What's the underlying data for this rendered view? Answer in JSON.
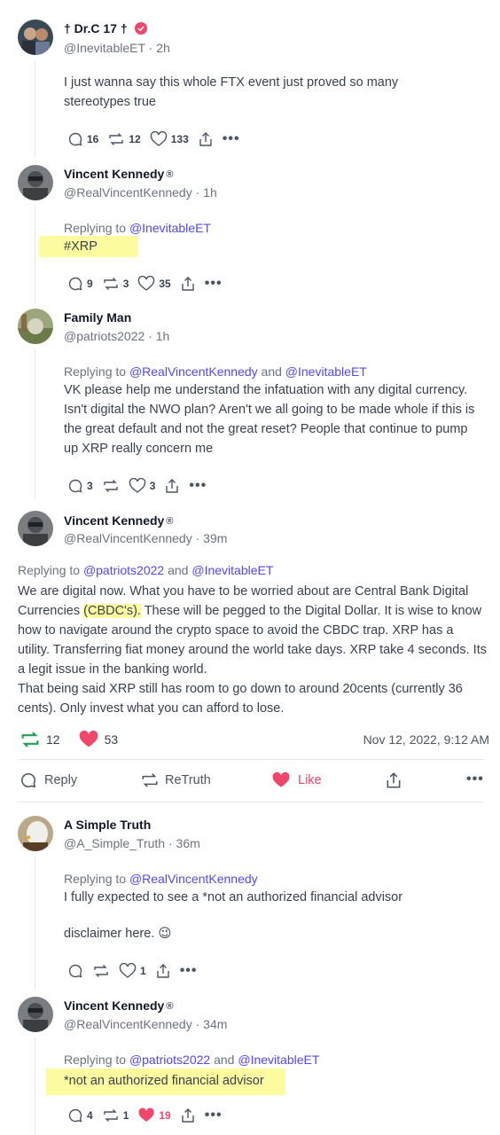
{
  "posts": [
    {
      "name": "† Dr.C 17 †",
      "handle": "@InevitableET",
      "time": "2h",
      "text": "I just wanna say this whole FTX event just proved so many stereotypes true",
      "replies": "16",
      "retruths": "12",
      "likes": "133"
    },
    {
      "name": "Vincent Kennedy",
      "handle": "@RealVincentKennedy",
      "time": "1h",
      "replying_label": "Replying to",
      "replying_to": "@InevitableET",
      "text": "#XRP",
      "replies": "9",
      "retruths": "3",
      "likes": "35"
    },
    {
      "name": "Family Man",
      "handle": "@patriots2022",
      "time": "1h",
      "replying_label": "Replying to",
      "replying_to": "@RealVincentKennedy",
      "and": "and",
      "replying_to2": "@InevitableET",
      "text": "VK please help me understand the infatuation with any digital currency.  Isn't digital the NWO plan? Aren't we all going to be made whole if this is the great default and not the great reset? People that continue to pump up XRP really concern me",
      "replies": "3",
      "likes": "3"
    },
    {
      "name": "Vincent Kennedy",
      "handle": "@RealVincentKennedy",
      "time": "39m",
      "replying_label": "Replying to",
      "replying_to": "@patriots2022",
      "and": "and",
      "replying_to2": "@InevitableET",
      "text_a": "We are digital now. What you have to be worried about are Central Bank Digital Currencies ",
      "text_hl": "(CBDC's).",
      "text_b": " These will be pegged to the Digital Dollar. It is wise to know how to navigate around the crypto space to avoid the CBDC trap. XRP has a utility. Transferring fiat money around the world take days. XRP take 4 seconds. Its a legit issue in the banking world.",
      "text_c": "That being said XRP still has room to go down to around 20cents (currently 36 cents). Only invest what you can afford to lose.",
      "retruths": "12",
      "likes": "53",
      "timestamp": "Nov 12, 2022, 9:12 AM",
      "bar": {
        "reply": "Reply",
        "retruth": "ReTruth",
        "like": "Like"
      }
    },
    {
      "name": "A Simple Truth",
      "handle": "@A_Simple_Truth",
      "time": "36m",
      "replying_label": "Replying to",
      "replying_to": "@RealVincentKennedy",
      "text_a": "I fully expected to see a *not an authorized financial advisor",
      "text_b": "disclaimer here. 😉",
      "likes": "1"
    },
    {
      "name": "Vincent Kennedy",
      "handle": "@RealVincentKennedy",
      "time": "34m",
      "replying_label": "Replying to",
      "replying_to": "@patriots2022",
      "and": "and",
      "replying_to2": "@InevitableET",
      "text": "*not an authorized financial advisor",
      "replies": "4",
      "retruths": "1",
      "likes": "19"
    }
  ],
  "sep": " · ",
  "more": "•••",
  "reg_mark": "®",
  "colors": {
    "link": "#5448ee",
    "like": "#f0466a",
    "retruth": "#22a052",
    "highlight": "#fdfba0"
  }
}
